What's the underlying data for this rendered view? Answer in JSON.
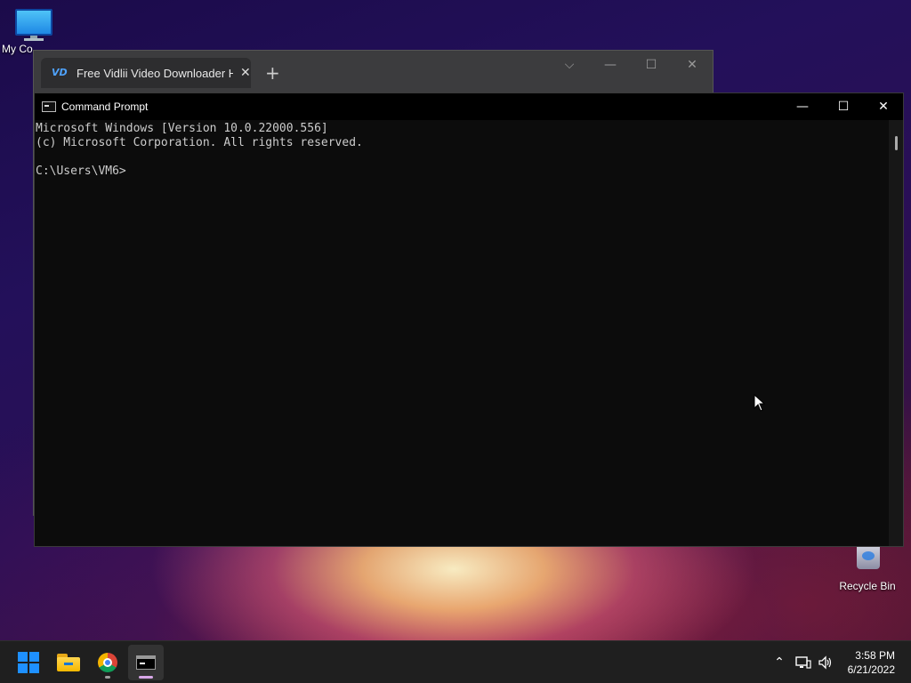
{
  "desktop": {
    "icons": [
      {
        "label": "My Co",
        "icon": "monitor-icon"
      },
      {
        "label": "Recycle Bin",
        "icon": "recycle-bin-icon"
      }
    ]
  },
  "background_window": {
    "tab_title": "Free Vidlii Video Downloader HD",
    "tab_close": "✕",
    "new_tab": "+",
    "controls": {
      "dropdown": "⌵",
      "minimize": "—",
      "maximize": "☐",
      "close": "✕"
    }
  },
  "cmd": {
    "title": "Command Prompt",
    "controls": {
      "minimize": "—",
      "maximize": "☐",
      "close": "✕"
    },
    "lines": [
      "Microsoft Windows [Version 10.0.22000.556]",
      "(c) Microsoft Corporation. All rights reserved.",
      "",
      "C:\\Users\\VM6>"
    ]
  },
  "taskbar": {
    "items": [
      {
        "name": "start",
        "icon": "windows-start-icon"
      },
      {
        "name": "file-explorer",
        "icon": "folder-icon"
      },
      {
        "name": "chrome",
        "icon": "chrome-icon"
      },
      {
        "name": "terminal",
        "icon": "command-prompt-icon"
      }
    ],
    "indicator_colors": {
      "chrome": "#9e9e9e",
      "terminal": "#d8a7e8"
    },
    "tray": {
      "chevron": "⌃",
      "network": "network-icon",
      "volume": "volume-icon"
    },
    "clock": {
      "time": "3:58 PM",
      "date": "6/21/2022"
    }
  }
}
